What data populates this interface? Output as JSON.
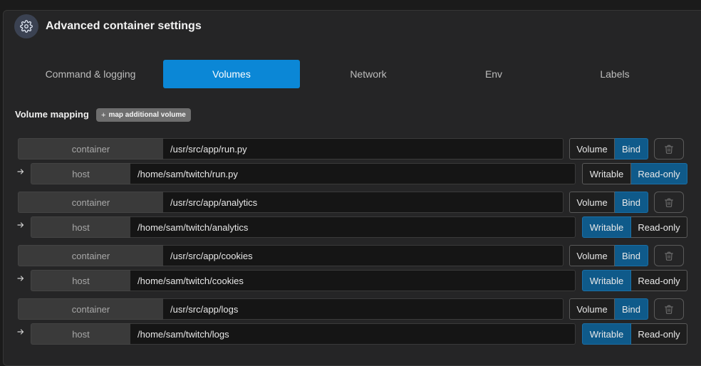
{
  "header": {
    "title": "Advanced container settings",
    "icon": "gear-icon"
  },
  "tabs": [
    {
      "label": "Command & logging",
      "active": false
    },
    {
      "label": "Volumes",
      "active": true
    },
    {
      "label": "Network",
      "active": false
    },
    {
      "label": "Env",
      "active": false
    },
    {
      "label": "Labels",
      "active": false
    }
  ],
  "volumes": {
    "label": "Volume mapping",
    "add_label": "map additional volume",
    "add_icon": "plus-icon",
    "container_label": "container",
    "host_label": "host",
    "mapping_type_options": [
      "Volume",
      "Bind"
    ],
    "access_options": [
      "Writable",
      "Read-only"
    ],
    "items": [
      {
        "container": "/usr/src/app/run.py",
        "host": "/home/sam/twitch/run.py",
        "type": "Bind",
        "access": "Read-only"
      },
      {
        "container": "/usr/src/app/analytics",
        "host": "/home/sam/twitch/analytics",
        "type": "Bind",
        "access": "Writable"
      },
      {
        "container": "/usr/src/app/cookies",
        "host": "/home/sam/twitch/cookies",
        "type": "Bind",
        "access": "Writable"
      },
      {
        "container": "/usr/src/app/logs",
        "host": "/home/sam/twitch/logs",
        "type": "Bind",
        "access": "Writable"
      }
    ]
  },
  "colors": {
    "accent": "#0b87d6",
    "toggle_on": "#0f5a8a",
    "panel": "#252526",
    "input_bg": "#151515"
  }
}
